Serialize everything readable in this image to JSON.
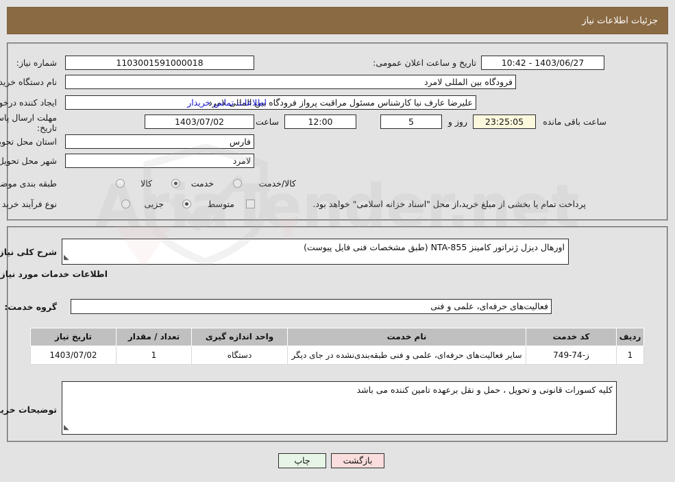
{
  "header": {
    "title": "جزئیات اطلاعات نیاز"
  },
  "form": {
    "need_number_label": "شماره نیاز:",
    "need_number_value": "1103001591000018",
    "public_announce_label": "تاریخ و ساعت اعلان عمومی:",
    "public_announce_value": "1403/06/27 - 10:42",
    "buyer_org_label": "نام دستگاه خریدار:",
    "buyer_org_value": "فرودگاه بین المللی لامرد",
    "creator_label": "ایجاد کننده درخواست:",
    "creator_value": "علیرضا عارف نیا کارشناس مسئول مراقبت پرواز فرودگاه بین المللی لامرد",
    "buyer_contact_link": "اطلاعات تماس خریدار",
    "deadline_label": "مهلت ارسال پاسخ: تا تاریخ:",
    "deadline_date": "1403/07/02",
    "hour_label": "ساعت",
    "deadline_time": "12:00",
    "days_remaining": "5",
    "days_unit_label": "روز و",
    "countdown": "23:25:05",
    "countdown_suffix_label": "ساعت باقی مانده",
    "province_label": "استان محل تحویل:",
    "province_value": "فارس",
    "city_label": "شهر محل تحویل:",
    "city_value": "لامرد",
    "category_label": "طبقه بندی موضوعی:",
    "category_options": [
      {
        "label": "کالا",
        "selected": false
      },
      {
        "label": "خدمت",
        "selected": true
      },
      {
        "label": "کالا/خدمت",
        "selected": false
      }
    ],
    "process_label": "نوع فرآیند خرید :",
    "process_options": [
      {
        "label": "جزیی",
        "selected": false
      },
      {
        "label": "متوسط",
        "selected": true
      }
    ],
    "treasury_checkbox_checked": false,
    "treasury_note": "پرداخت تمام یا بخشی از مبلغ خرید،از محل \"اسناد خزانه اسلامی\" خواهد بود."
  },
  "description": {
    "label": "شرح کلی نیاز:",
    "value": "اورهال دیزل ژنراتور کامینز NTA-855 (طبق مشخصات فنی فایل پیوست)"
  },
  "services": {
    "section_title": "اطلاعات خدمات مورد نیاز",
    "group_label": "گروه خدمت:",
    "group_value": "فعالیت‌های حرفه‌ای، علمی و فنی",
    "columns": [
      "ردیف",
      "کد خدمت",
      "نام خدمت",
      "واحد اندازه گیری",
      "تعداد / مقدار",
      "تاریخ نیاز"
    ],
    "rows": [
      {
        "row": "1",
        "code": "ز-74-749",
        "name": "سایر فعالیت‌های حرفه‌ای، علمی و فنی طبقه‌بندی‌نشده در جای دیگر",
        "unit": "دستگاه",
        "quantity": "1",
        "date": "1403/07/02"
      }
    ]
  },
  "buyer_notes": {
    "label": "توضیحات خریدار:",
    "value": "کلیه کسورات قانونی و تحویل ، حمل و نقل برعهده تامین کننده می باشد"
  },
  "footer": {
    "print_label": "چاپ",
    "back_label": "بازگشت"
  },
  "watermark": {
    "text": "AriaTender.net"
  },
  "colors": {
    "titlebar_bg": "#8a6a43",
    "page_bg": "#e3e3e3",
    "link": "#1414cc",
    "timer_bg": "#fbf8dd",
    "table_header_bg": "#c0c0c0",
    "print_btn_bg": "#e6f5e6",
    "back_btn_bg": "#fadddd"
  }
}
